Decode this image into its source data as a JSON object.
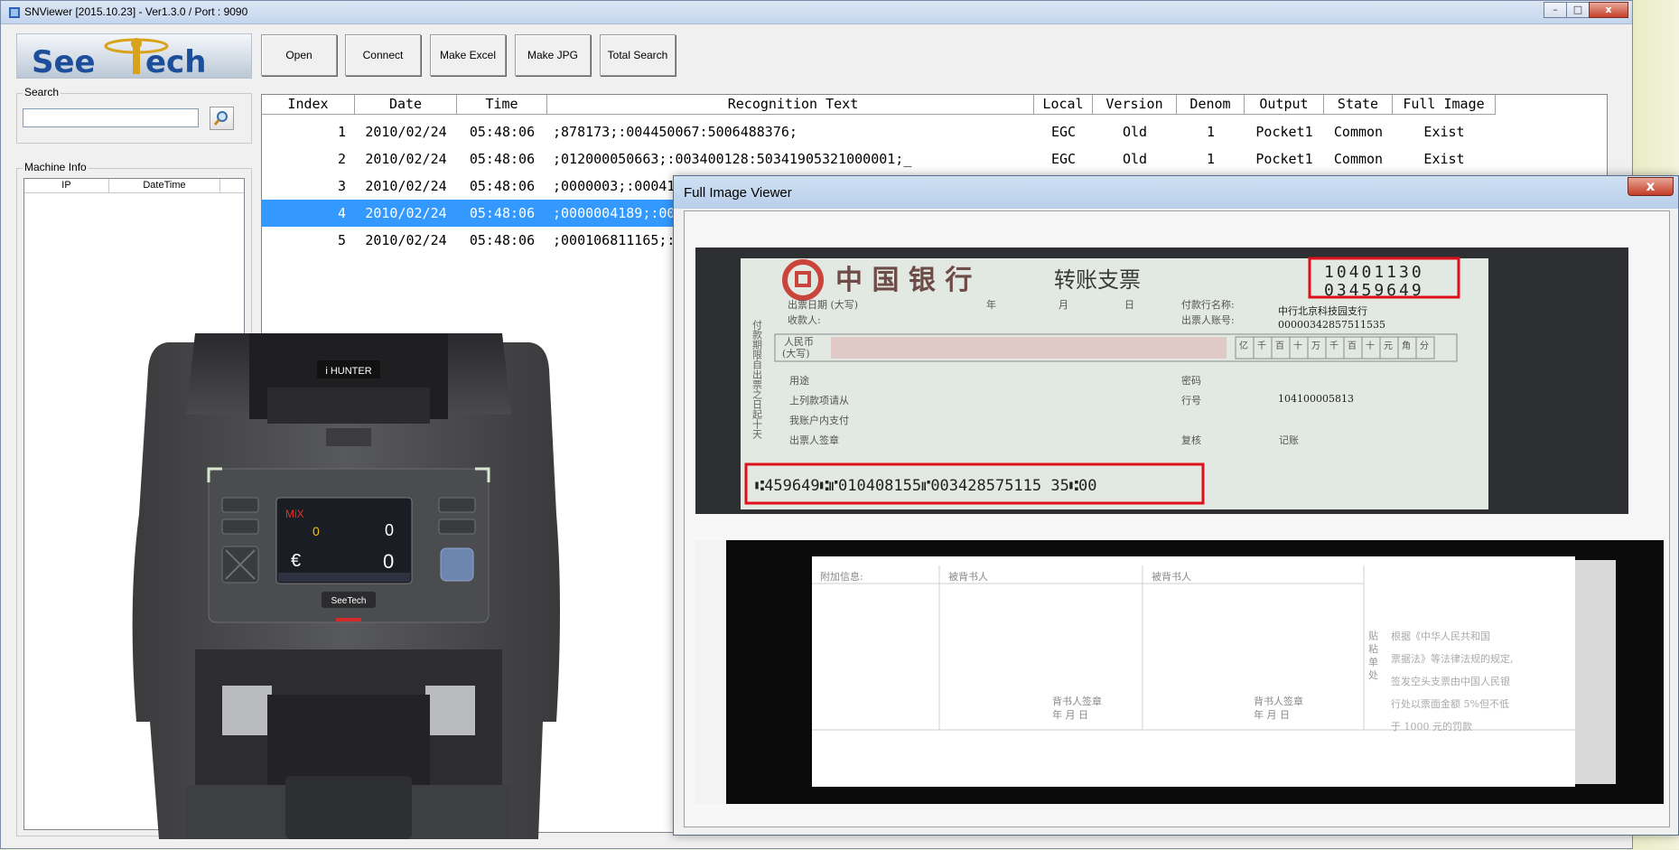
{
  "window": {
    "title": "SNViewer [2015.10.23] - Ver1.3.0 / Port : 9090",
    "controls": {
      "minimize": "–",
      "maximize": "□",
      "close": "x"
    }
  },
  "logo": {
    "text_see": "See",
    "text_ech": "ech"
  },
  "toolbar": {
    "open": "Open",
    "connect": "Connect",
    "make_excel": "Make Excel",
    "make_jpg": "Make JPG",
    "total_search": "Total Search"
  },
  "search": {
    "label": "Search",
    "value": "",
    "icon": "magnifier-icon"
  },
  "machine_info": {
    "label": "Machine Info",
    "columns": [
      "IP",
      "DateTime"
    ]
  },
  "grid": {
    "columns": [
      "Index",
      "Date",
      "Time",
      "Recognition Text",
      "Local",
      "Version",
      "Denom",
      "Output",
      "State",
      "Full Image"
    ],
    "selected_index": 3,
    "rows": [
      {
        "index": "1",
        "date": "2010/02/24",
        "time": "05:48:06",
        "text": ";878173;:004450067:5006488376;",
        "local": "EGC",
        "version": "Old",
        "denom": "1",
        "output": "Pocket1",
        "state": "Common",
        "full_image": "Exist"
      },
      {
        "index": "2",
        "date": "2010/02/24",
        "time": "05:48:06",
        "text": ";012000050663;:003400128:50341905321000001;_",
        "local": "EGC",
        "version": "Old",
        "denom": "1",
        "output": "Pocket1",
        "state": "Common",
        "full_image": "Exist"
      },
      {
        "index": "3",
        "date": "2010/02/24",
        "time": "05:48:06",
        "text": ";0000003;:00041",
        "local": "",
        "version": "",
        "denom": "",
        "output": "",
        "state": "",
        "full_image": ""
      },
      {
        "index": "4",
        "date": "2010/02/24",
        "time": "05:48:06",
        "text": ";0000004189;:00",
        "local": "",
        "version": "",
        "denom": "",
        "output": "",
        "state": "",
        "full_image": ""
      },
      {
        "index": "5",
        "date": "2010/02/24",
        "time": "05:48:06",
        "text": ";000106811165;:",
        "local": "",
        "version": "",
        "denom": "",
        "output": "",
        "state": "",
        "full_image": ""
      }
    ]
  },
  "machine_photo": {
    "brand": "i HUNTER",
    "screen_mode": "MiX",
    "screen_count": "0",
    "screen_amount": "0",
    "screen_currency": "€",
    "screen_total": "0",
    "footer_brand": "SeeTech"
  },
  "viewer": {
    "title": "Full Image Viewer",
    "close": "x",
    "front": {
      "bank_name": "中 国 银 行",
      "doc_type": "转账支票",
      "serial_top": "10401130",
      "serial_bottom": "03459649",
      "issue_date_label": "出票日期 (大写)",
      "date_parts": [
        "年",
        "月",
        "日"
      ],
      "payee_label": "收款人:",
      "paying_bank_label": "付款行名称:",
      "paying_bank": "中行北京科技园支行",
      "account_label": "出票人账号:",
      "account": "00000342857511535",
      "rmb_label": "人民币",
      "rmb_sub": "(大写)",
      "digit_units": [
        "亿",
        "千",
        "百",
        "十",
        "万",
        "千",
        "百",
        "十",
        "元",
        "角",
        "分"
      ],
      "purpose_label": "用途",
      "password_label": "密码",
      "instruction_1": "上列款项请从",
      "instruction_2": "我账户内支付",
      "drawer_sign": "出票人签章",
      "bank_no_label": "行号",
      "bank_no": "104100005813",
      "review_label": "复核",
      "record_label": "记账",
      "side_text": "付款期限自出票之日起十天",
      "micr": "⑆459649⑆⑈010408155⑈003428575115 35⑆00"
    },
    "back": {
      "attach_label": "附加信息:",
      "endorsee_1": "被背书人",
      "endorsee_2": "被背书人",
      "endorser_sign_1": "背书人签章",
      "endorser_date_1": "年  月  日",
      "endorser_sign_2": "背书人签章",
      "endorser_date_2": "年  月  日",
      "stick_label": "贴 粘 单 处",
      "notice_1": "根据《中华人民共和国",
      "notice_2": "票据法》等法律法规的规定,",
      "notice_3": "签发空头支票由中国人民银",
      "notice_4": "行处以票面金额 5%但不低",
      "notice_5": "于 1000 元的罚款"
    }
  },
  "colors": {
    "selection": "#3399ff",
    "highlight_box": "#e0101a",
    "title_gradient_top": "#dbe6f4",
    "logo_blue": "#1d4e9a",
    "logo_gold": "#d9a21b"
  }
}
